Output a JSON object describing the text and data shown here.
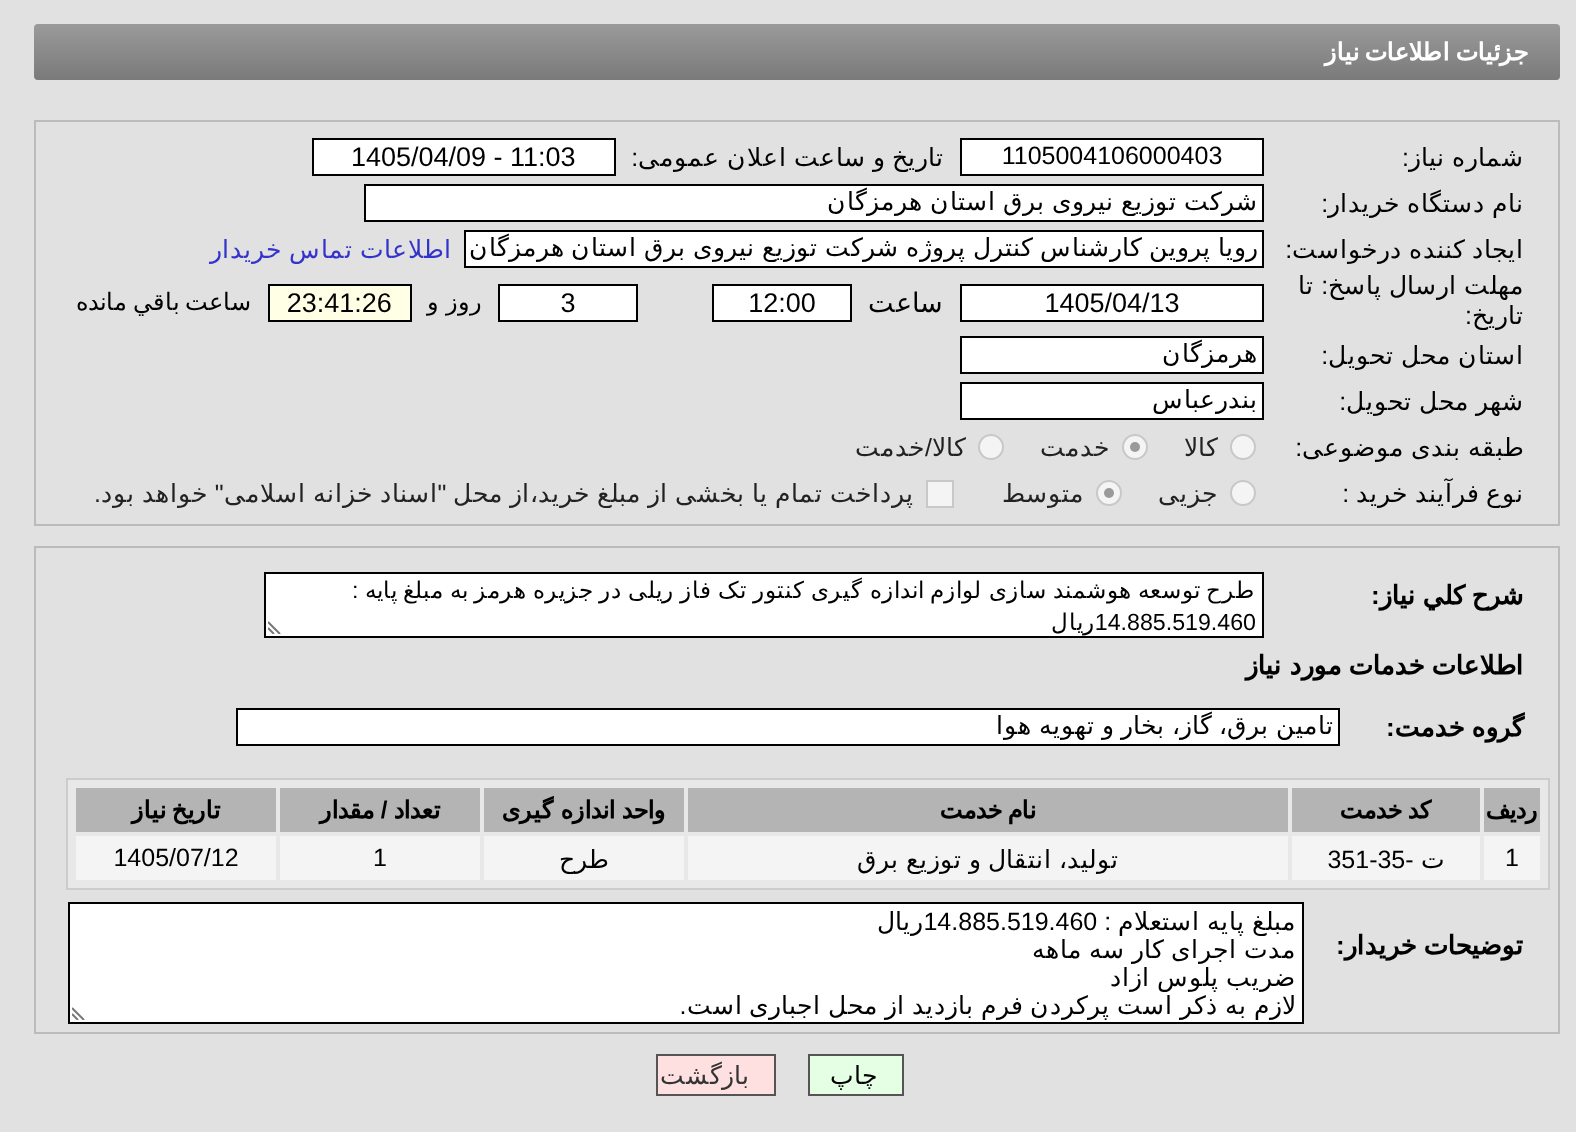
{
  "header": {
    "title": "جزئیات اطلاعات نیاز"
  },
  "details": {
    "need_number": {
      "label": "شماره نیاز:",
      "value": "1105004106000403"
    },
    "announce": {
      "label": "تاریخ و ساعت اعلان عمومی:",
      "value": "1405/04/09 - 11:03"
    },
    "buyer_org": {
      "label": "نام دستگاه خریدار:",
      "value": "شرکت توزیع نیروی برق استان هرمزگان"
    },
    "creator": {
      "label": "ایجاد کننده درخواست:",
      "value": "رویا پروین کارشناس کنترل پروژه شرکت توزیع نیروی برق استان هرمزگان",
      "link": "اطلاعات تماس خریدار"
    },
    "deadline": {
      "label": "مهلت ارسال پاسخ: تا تاریخ:",
      "date": "1405/04/13",
      "time_label": "ساعت",
      "time": "12:00",
      "days": "3",
      "days_label": "روز و",
      "remaining": "23:41:26",
      "remaining_label": "ساعت باقي مانده"
    },
    "province": {
      "label": "استان محل تحویل:",
      "value": "هرمزگان"
    },
    "city": {
      "label": "شهر محل تحویل:",
      "value": "بندرعباس"
    },
    "category": {
      "label": "طبقه بندی موضوعی:",
      "options": [
        {
          "label": "کالا",
          "selected": false
        },
        {
          "label": "خدمت",
          "selected": true
        },
        {
          "label": "کالا/خدمت",
          "selected": false
        }
      ]
    },
    "process": {
      "label": "نوع فرآیند خرید :",
      "options": [
        {
          "label": "جزیی",
          "selected": false
        },
        {
          "label": "متوسط",
          "selected": true
        }
      ],
      "treasury": {
        "checked": false,
        "label": "پرداخت تمام یا بخشی از مبلغ خرید،از محل \"اسناد خزانه اسلامی\" خواهد بود."
      }
    }
  },
  "summary": {
    "label": "شرح کلي نیاز:",
    "value": "طرح توسعه هوشمند سازی لوازم اندازه گیری کنتور تک فاز ریلی در جزیره هرمز به مبلغ پایه  :  14.885.519.460ریال"
  },
  "services_heading": "اطلاعات خدمات مورد نیاز",
  "service_group": {
    "label": "گروه خدمت:",
    "value": "تامین برق، گاز، بخار و تهویه هوا"
  },
  "table": {
    "columns": [
      "ردیف",
      "کد خدمت",
      "نام خدمت",
      "واحد اندازه گیری",
      "تعداد / مقدار",
      "تاریخ نیاز"
    ],
    "rows": [
      [
        "1",
        "ت -35-351",
        "تولید، انتقال و توزیع برق",
        "طرح",
        "1",
        "1405/07/12"
      ]
    ]
  },
  "buyer_notes": {
    "label": "توضیحات خریدار:",
    "value": "مبلغ پایه استعلام : 14.885.519.460ریال\nمدت اجرای کار سه ماهه\nضریب پلوس ازاد\nلازم به ذکر است پرکردن فرم بازدید از محل اجباری است."
  },
  "buttons": [
    {
      "label": "چاپ",
      "kind": "print"
    },
    {
      "label": "بازگشت",
      "kind": "back"
    }
  ]
}
